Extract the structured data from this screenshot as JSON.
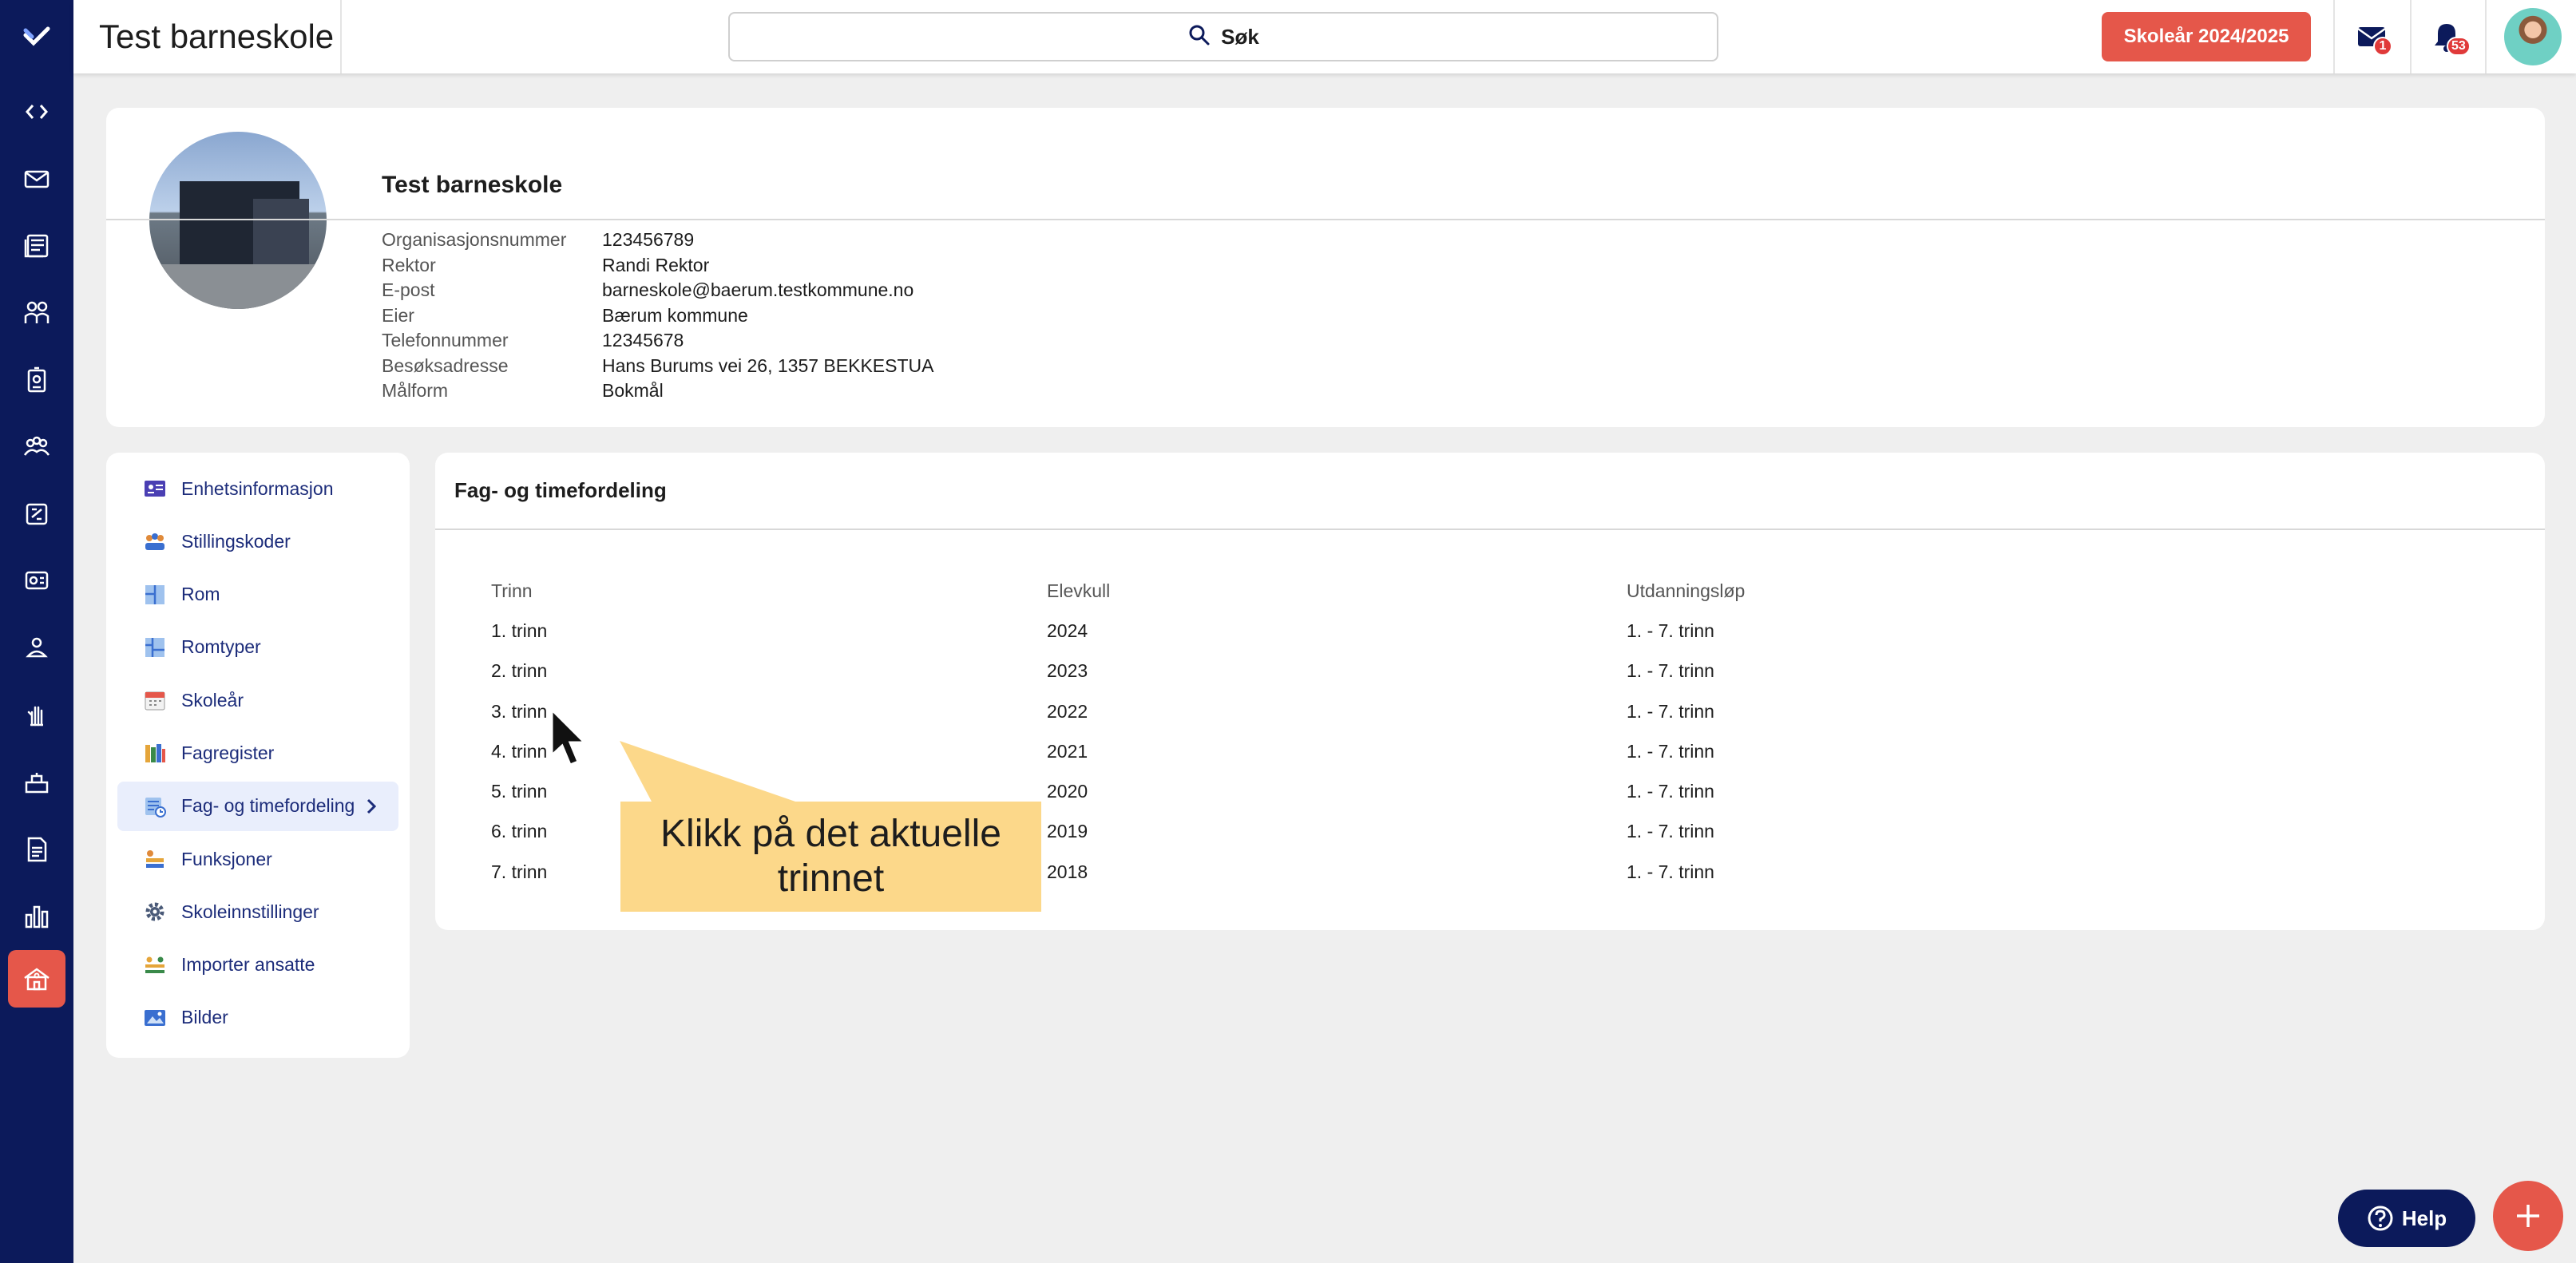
{
  "app": {
    "title": "Test barneskole"
  },
  "topbar": {
    "search_label": "Søk",
    "school_year_button": "Skoleår 2024/2025",
    "mail_badge": "1",
    "notifications_badge": "53"
  },
  "rail": {
    "items": [
      "logo-icon",
      "code-icon",
      "mail-icon",
      "news-icon",
      "people-icon",
      "badge-icon",
      "group-icon",
      "puzzle-icon",
      "chat-icon",
      "person-icon",
      "hand-icon",
      "desk-icon",
      "document-icon",
      "chart-icon",
      "school-icon"
    ],
    "active_item": "school-icon"
  },
  "profile": {
    "name": "Test barneskole",
    "fields": [
      {
        "key": "Organisasjonsnummer",
        "value": "123456789"
      },
      {
        "key": "Rektor",
        "value": "Randi Rektor"
      },
      {
        "key": "E-post",
        "value": "barneskole@baerum.testkommune.no"
      },
      {
        "key": "Eier",
        "value": "Bærum kommune"
      },
      {
        "key": "Telefonnummer",
        "value": "12345678"
      },
      {
        "key": "Besøksadresse",
        "value": "Hans Burums vei 26, 1357 BEKKESTUA"
      },
      {
        "key": "Målform",
        "value": "Bokmål"
      }
    ]
  },
  "menu": {
    "items": [
      {
        "label": "Enhetsinformasjon",
        "icon": "id-card-icon"
      },
      {
        "label": "Stillingskoder",
        "icon": "staff-icon"
      },
      {
        "label": "Rom",
        "icon": "room-icon"
      },
      {
        "label": "Romtyper",
        "icon": "room-types-icon"
      },
      {
        "label": "Skoleår",
        "icon": "calendar-icon"
      },
      {
        "label": "Fagregister",
        "icon": "books-icon"
      },
      {
        "label": "Fag- og timefordeling",
        "icon": "schedule-icon",
        "active": true
      },
      {
        "label": "Funksjoner",
        "icon": "functions-icon"
      },
      {
        "label": "Skoleinnstillinger",
        "icon": "gear-icon"
      },
      {
        "label": "Importer ansatte",
        "icon": "import-icon"
      },
      {
        "label": "Bilder",
        "icon": "image-icon"
      }
    ]
  },
  "content": {
    "title": "Fag- og timefordeling",
    "columns": [
      "Trinn",
      "Elevkull",
      "Utdanningsløp"
    ],
    "rows": [
      [
        "1. trinn",
        "2024",
        "1. - 7. trinn"
      ],
      [
        "2. trinn",
        "2023",
        "1. - 7. trinn"
      ],
      [
        "3. trinn",
        "2022",
        "1. - 7. trinn"
      ],
      [
        "4. trinn",
        "2021",
        "1. - 7. trinn"
      ],
      [
        "5. trinn",
        "2020",
        "1. - 7. trinn"
      ],
      [
        "6. trinn",
        "2019",
        "1. - 7. trinn"
      ],
      [
        "7. trinn",
        "2018",
        "1. - 7. trinn"
      ]
    ]
  },
  "callout": {
    "text": "Klikk på det aktuelle trinnet"
  },
  "floating": {
    "help_label": "Help"
  },
  "colors": {
    "rail": "#0c1a5b",
    "accent": "#e5574a",
    "callout": "#fcd88a",
    "menu_text": "#1c2c7a"
  }
}
